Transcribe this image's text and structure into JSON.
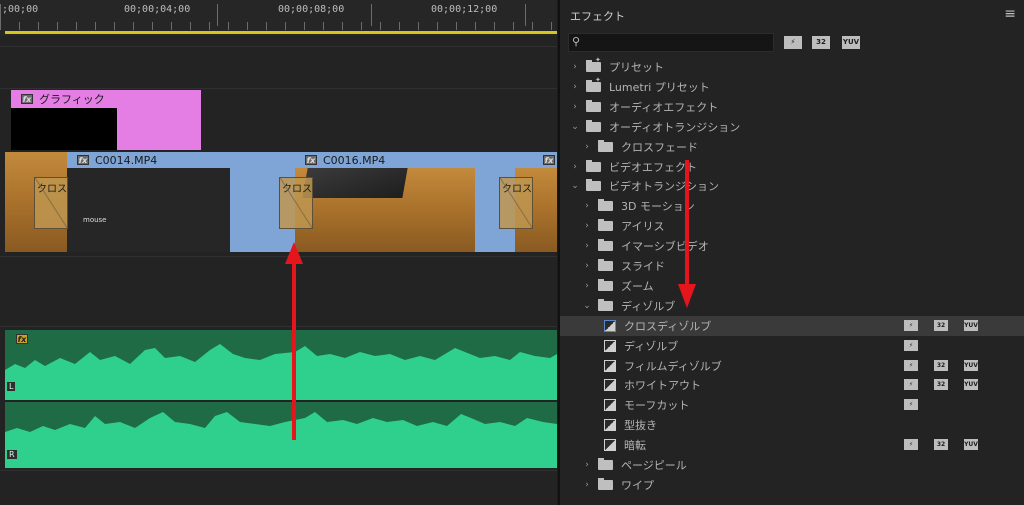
{
  "timeline": {
    "timecodes": [
      ";00;00",
      "00;00;04;00",
      "00;00;08;00",
      "00;00;12;00"
    ],
    "graphic_clip": {
      "fx": "fx",
      "label": "グラフィック"
    },
    "video_clips": [
      {
        "fx": "fx",
        "label": "C0014.MP4"
      },
      {
        "fx": "fx",
        "label": "C0016.MP4"
      },
      {
        "fx": "fx",
        "label": ""
      }
    ],
    "transitions": [
      "クロス",
      "クロス",
      "クロス"
    ],
    "clip_logo": "mouse",
    "audio_fx": "fx",
    "channels": [
      "L",
      "R"
    ]
  },
  "effects": {
    "title": "エフェクト",
    "menu_icon": "≡",
    "search": {
      "value": "",
      "placeholder": ""
    },
    "filters": [
      "⚡",
      "32",
      "YUV"
    ],
    "tree": [
      {
        "label": "プリセット",
        "expanded": false,
        "icon": "preset-folder"
      },
      {
        "label": "Lumetri プリセット",
        "expanded": false,
        "icon": "preset-folder"
      },
      {
        "label": "オーディオエフェクト",
        "expanded": false,
        "icon": "folder"
      },
      {
        "label": "オーディオトランジション",
        "expanded": true,
        "icon": "folder"
      },
      {
        "label": "クロスフェード",
        "expanded": false,
        "icon": "folder",
        "depth": 1
      },
      {
        "label": "ビデオエフェクト",
        "expanded": false,
        "icon": "folder"
      },
      {
        "label": "ビデオトランジション",
        "expanded": true,
        "icon": "folder"
      },
      {
        "label": "3D モーション",
        "expanded": false,
        "icon": "folder",
        "depth": 1
      },
      {
        "label": "アイリス",
        "expanded": false,
        "icon": "folder",
        "depth": 1
      },
      {
        "label": "イマーシブビデオ",
        "expanded": false,
        "icon": "folder",
        "depth": 1
      },
      {
        "label": "スライド",
        "expanded": false,
        "icon": "folder",
        "depth": 1
      },
      {
        "label": "ズーム",
        "expanded": false,
        "icon": "folder",
        "depth": 1
      },
      {
        "label": "ディゾルブ",
        "expanded": true,
        "icon": "folder",
        "depth": 1
      },
      {
        "label": "クロスディゾルブ",
        "icon": "effect",
        "depth": 2,
        "selected": true,
        "badges": [
          "⚡",
          "32",
          "YUV"
        ]
      },
      {
        "label": "ディゾルブ",
        "icon": "effect",
        "depth": 2,
        "badges": [
          "⚡"
        ]
      },
      {
        "label": "フィルムディゾルブ",
        "icon": "effect",
        "depth": 2,
        "badges": [
          "⚡",
          "32",
          "YUV"
        ]
      },
      {
        "label": "ホワイトアウト",
        "icon": "effect",
        "depth": 2,
        "badges": [
          "⚡",
          "32",
          "YUV"
        ]
      },
      {
        "label": "モーフカット",
        "icon": "effect",
        "depth": 2,
        "badges": [
          "⚡"
        ]
      },
      {
        "label": "型抜き",
        "icon": "effect",
        "depth": 2,
        "badges": []
      },
      {
        "label": "暗転",
        "icon": "effect",
        "depth": 2,
        "badges": [
          "⚡",
          "32",
          "YUV"
        ]
      },
      {
        "label": "ページピール",
        "expanded": false,
        "icon": "folder",
        "depth": 1
      },
      {
        "label": "ワイプ",
        "expanded": false,
        "icon": "folder",
        "depth": 1
      }
    ]
  },
  "colors": {
    "graphic_clip": "#e47ee4",
    "video_clip": "#7fa4d6",
    "audio_clip": "#1e6b45",
    "waveform": "#2fd08e",
    "annotation_arrow": "#e4161b",
    "work_area_bar": "#d7c61a"
  }
}
